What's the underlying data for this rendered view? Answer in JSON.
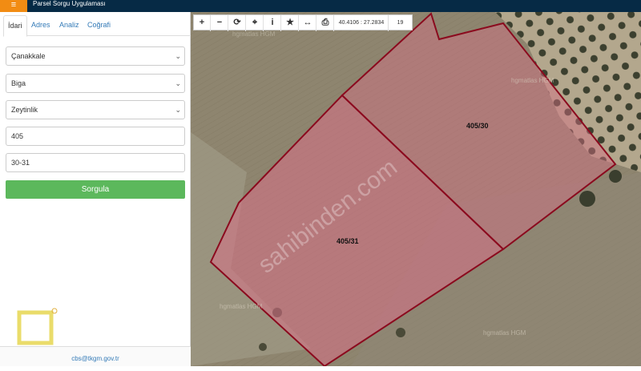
{
  "header": {
    "title": "Parsel Sorgu Uygulaması",
    "menu_icon": "hamburger-icon"
  },
  "tabs": [
    {
      "label": "İdari",
      "active": true
    },
    {
      "label": "Adres",
      "active": false
    },
    {
      "label": "Analiz",
      "active": false
    },
    {
      "label": "Coğrafi",
      "active": false
    }
  ],
  "form": {
    "province": "Çanakkale",
    "district": "Biga",
    "neighborhood": "Zeytinlik",
    "block_no": "405",
    "parcel_no": "30-31",
    "submit_label": "Sorgula"
  },
  "footer": {
    "email": "cbs@tkgm.gov.tr"
  },
  "toolbar": {
    "icons": [
      "zoom-in-icon",
      "zoom-out-icon",
      "refresh-icon",
      "locate-icon",
      "info-icon",
      "star-icon",
      "measure-icon",
      "print-icon"
    ],
    "coordinates": "40.4106 : 27.2834",
    "zoom_level": "19"
  },
  "map": {
    "parcels": [
      "405/30",
      "405/31"
    ],
    "watermarks": [
      "hgmatlas HGM",
      "hgmatlas HGM",
      "hgmatlas HGM",
      "hgmatlas HGM"
    ],
    "site_watermark": "sahibinden.com",
    "colors": {
      "parcel_fill": "#e0708a",
      "parcel_border": "#8b0a1e",
      "accent": "#062a45",
      "button": "#5cb85c",
      "menu": "#f28c13"
    }
  }
}
